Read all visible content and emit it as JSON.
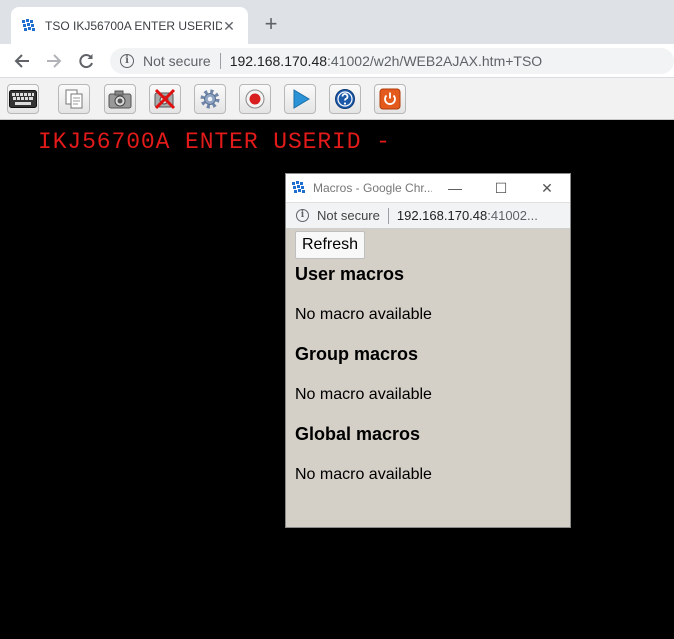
{
  "browser": {
    "tab_title": "TSO IKJ56700A ENTER USERID -",
    "tab_close": "✕",
    "new_tab": "+",
    "security_label": "Not secure",
    "url_host": "192.168.170.48",
    "url_rest": ":41002/w2h/WEB2AJAX.htm+TSO"
  },
  "toolbar": {
    "buttons": [
      {
        "icon": "keyboard-icon"
      },
      {
        "icon": "copy-icon"
      },
      {
        "icon": "camera-icon"
      },
      {
        "icon": "disconnect-icon"
      },
      {
        "icon": "settings-gear-icon"
      },
      {
        "icon": "record-icon"
      },
      {
        "icon": "play-icon"
      },
      {
        "icon": "help-icon"
      },
      {
        "icon": "power-icon"
      }
    ]
  },
  "terminal": {
    "line1": "IKJ56700A ENTER USERID -",
    "text_color": "#e21a1a"
  },
  "popup": {
    "title": "Macros - Google Chr...",
    "minimize": "—",
    "maximize": "☐",
    "close": "✕",
    "security_label": "Not secure",
    "url_host": "192.168.170.48",
    "url_rest": ":41002...",
    "refresh_label": "Refresh",
    "sections": [
      {
        "heading": "User macros",
        "text": "No macro available"
      },
      {
        "heading": "Group macros",
        "text": "No macro available"
      },
      {
        "heading": "Global macros",
        "text": "No macro available"
      }
    ]
  }
}
